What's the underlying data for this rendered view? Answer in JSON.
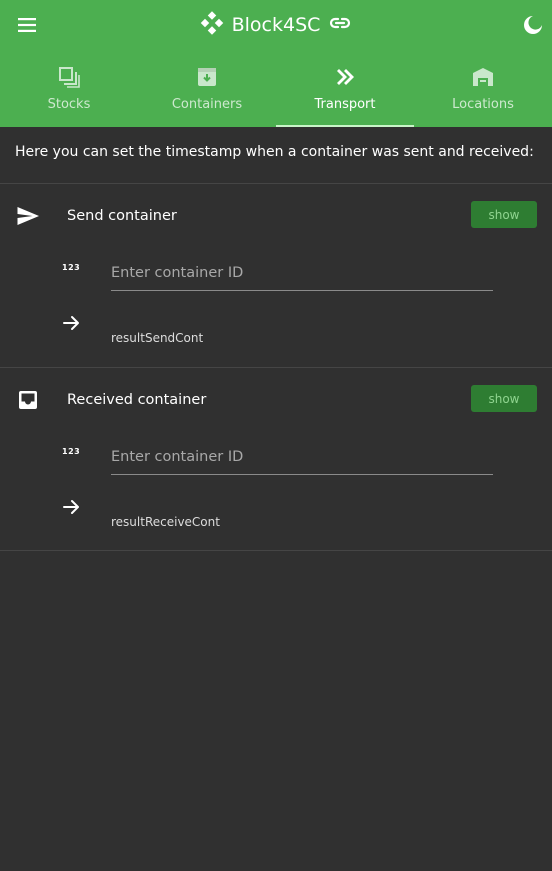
{
  "app": {
    "title": "Block4SC",
    "menu_icon": "hamburger-menu-icon",
    "logo_icon": "diamond-blocks-logo-icon",
    "link_icon": "chain-link-icon",
    "theme_icon": "moon-icon"
  },
  "tabs": [
    {
      "label": "Stocks",
      "icon": "stacked-squares-icon",
      "active": false
    },
    {
      "label": "Containers",
      "icon": "archive-box-icon",
      "active": false
    },
    {
      "label": "Transport",
      "icon": "double-chevron-right-icon",
      "active": true
    },
    {
      "label": "Locations",
      "icon": "warehouse-icon",
      "active": false
    }
  ],
  "intro_text": "Here you can set the timestamp when a container was sent and received:",
  "send": {
    "title": "Send container",
    "icon": "send-icon",
    "show_label": "show",
    "id_icon_text": "123",
    "placeholder": "Enter container ID",
    "value": "",
    "result": "resultSendCont"
  },
  "receive": {
    "title": "Received container",
    "icon": "inbox-icon",
    "show_label": "show",
    "id_icon_text": "123",
    "placeholder": "Enter container ID",
    "value": "",
    "result": "resultReceiveCont"
  },
  "colors": {
    "primary": "#4caf50",
    "button_bg": "#2e7d32",
    "button_text": "#8fd48f",
    "background": "#303030",
    "active_indicator": "#c8f5c8"
  }
}
